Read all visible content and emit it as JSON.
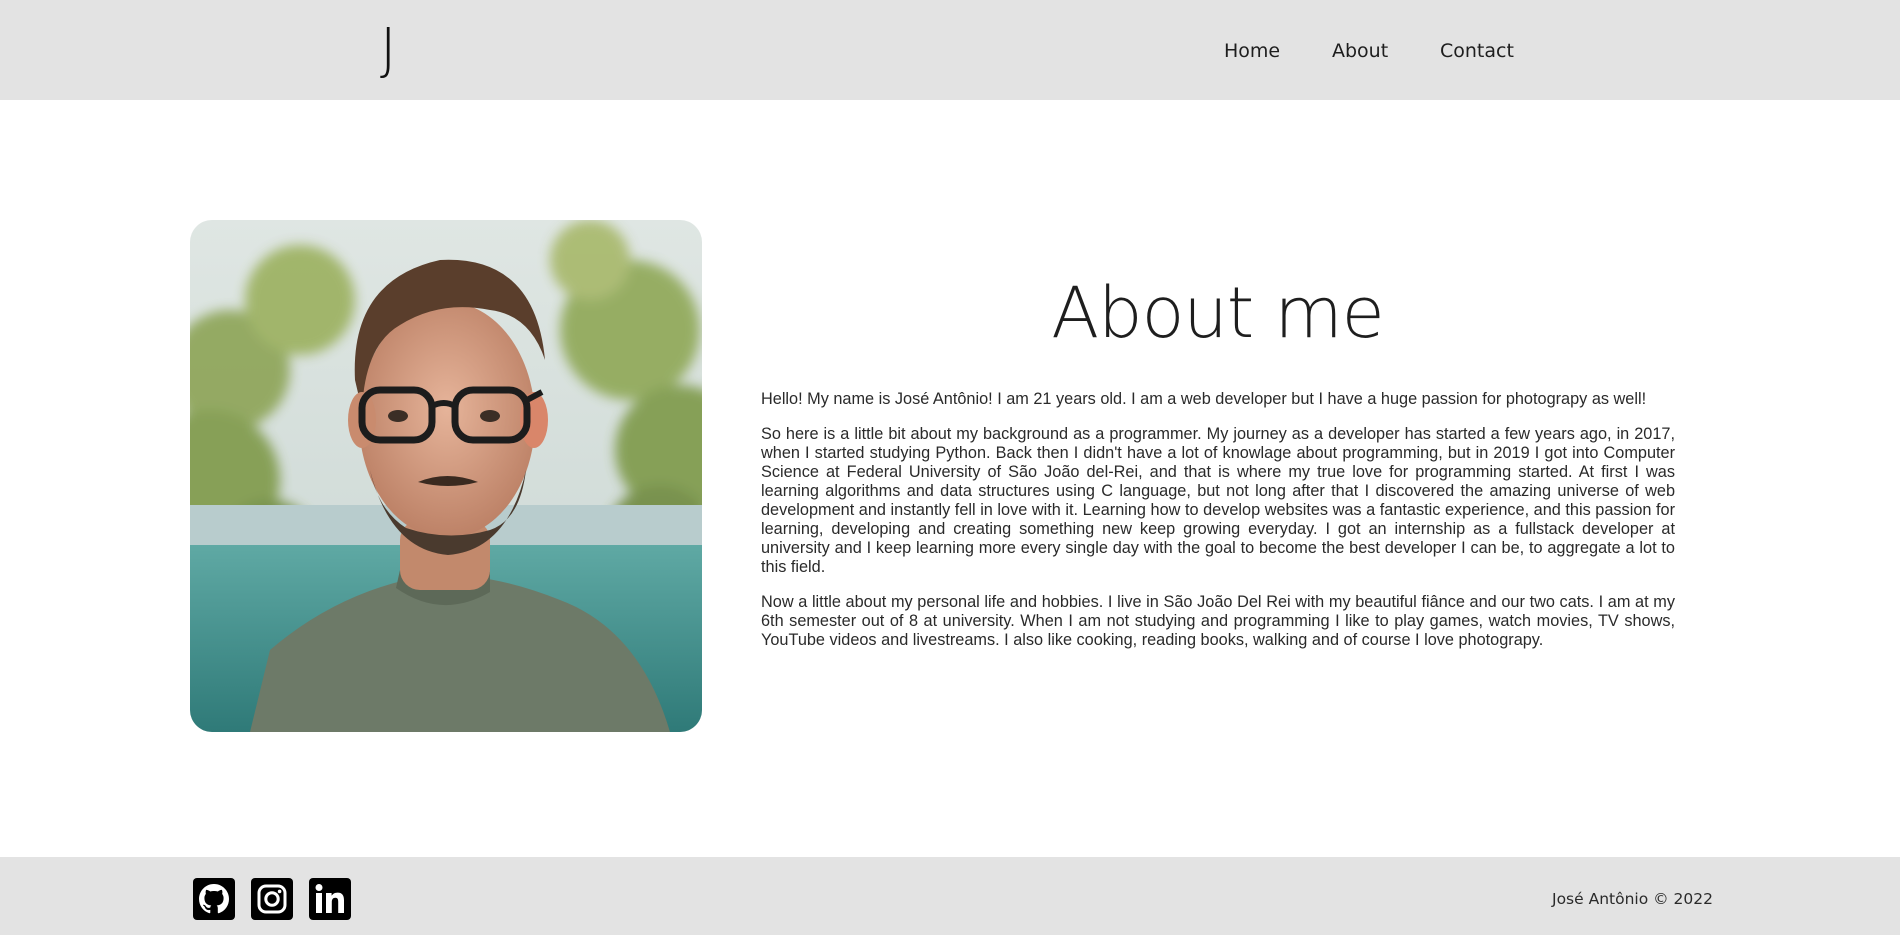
{
  "header": {
    "logo": "J",
    "nav": [
      {
        "label": "Home"
      },
      {
        "label": "About"
      },
      {
        "label": "Contact"
      }
    ]
  },
  "about": {
    "title": "About me",
    "paragraphs": [
      "Hello! My name is José Antônio! I am 21 years old. I am a web developer but I have a huge passion for photograpy as well!",
      "So here is a little bit about my background as a programmer. My journey as a developer has started a few years ago, in 2017, when I started studying Python. Back then I didn't have a lot of knowlage about programming, but in 2019 I got into Computer Science at Federal University of São João del-Rei, and that is where my true love for programming started. At first I was learning algorithms and data structures using C language, but not long after that I discovered the amazing universe of web development and instantly fell in love with it. Learning how to develop websites was a fantastic experience, and this passion for learning, developing and creating something new keep growing everyday. I got an internship as a fullstack developer at university and I keep learning more every single day with the goal to become the best developer I can be, to aggregate a lot to this field.",
      "Now a little about my personal life and hobbies. I live in São João Del Rei with my beautiful fiânce and our two cats. I am at my 6th semester out of 8 at university. When I am not studying and programming I like to play games, watch movies, TV shows, YouTube videos and livestreams. I also like cooking, reading books, walking and of course I love photograpy."
    ]
  },
  "footer": {
    "social": [
      {
        "icon": "github-icon"
      },
      {
        "icon": "instagram-icon"
      },
      {
        "icon": "linkedin-icon"
      }
    ],
    "copyright": "José Antônio © 2022"
  },
  "colors": {
    "bar_background": "#e3e3e3",
    "text": "#1e1e1e"
  }
}
